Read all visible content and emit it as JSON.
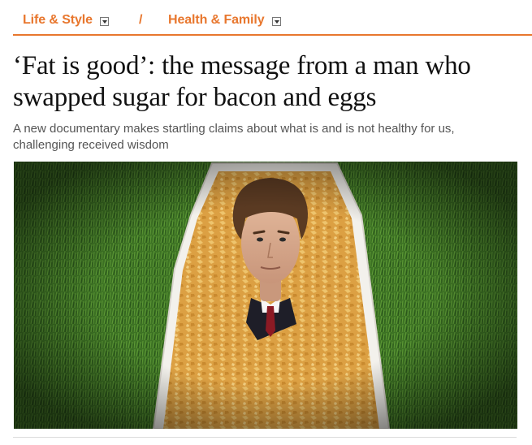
{
  "nav": {
    "section_1": "Life & Style",
    "separator": "/",
    "section_2": "Health & Family"
  },
  "article": {
    "headline": "‘Fat is good’: the message from a man who swapped sugar for bacon and eggs",
    "standfirst": "A new documentary makes startling claims about what is and is not healthy for us, challenging received wisdom",
    "image_icon": "photo-man-in-coffin-of-cornflakes"
  },
  "colors": {
    "accent": "#e8772e",
    "grass": "#3b6f22",
    "cornflakes": "#e2a84b"
  }
}
